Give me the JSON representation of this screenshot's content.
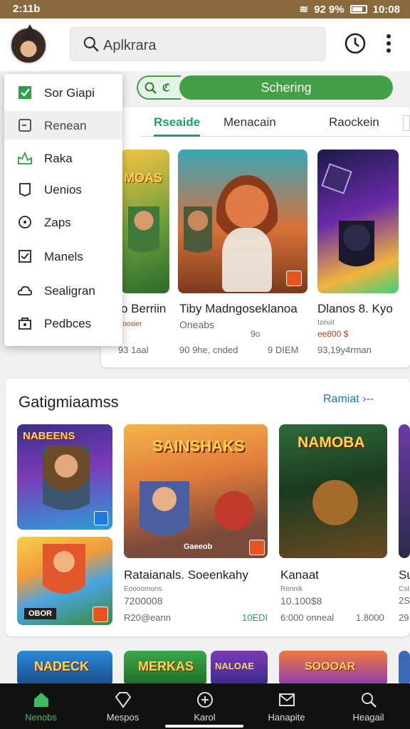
{
  "status": {
    "time": "2:11b",
    "right": "92 9% ",
    "clock": "10:08"
  },
  "search": {
    "placeholder": "Aplkrara"
  },
  "filter": {
    "button_label": "Schering",
    "search_mark": "ℭ"
  },
  "tabs": [
    {
      "label": "Rseaide",
      "active": true
    },
    {
      "label": "Menacain",
      "active": false
    },
    {
      "label": "Raockein",
      "active": false
    }
  ],
  "menu": [
    {
      "label": "Sor Giapi",
      "icon": "check-square-icon"
    },
    {
      "label": "Renean",
      "icon": "note-icon",
      "selected": true
    },
    {
      "label": "Raka",
      "icon": "chart-icon"
    },
    {
      "label": "Uenios",
      "icon": "bookmark-icon"
    },
    {
      "label": "Zaps",
      "icon": "compass-icon"
    },
    {
      "label": "Manels",
      "icon": "check-box-icon"
    },
    {
      "label": "Sealigran",
      "icon": "cloud-icon"
    },
    {
      "label": "Pedbces",
      "icon": "bag-icon"
    }
  ],
  "top_games": [
    {
      "title": "o Berriin",
      "sub": "ioosier",
      "meta": "93 1aal"
    },
    {
      "title": "Tiby Madngoseklanoa",
      "sub": "Oneabs",
      "rating": "9o",
      "meta": "90 9he, cnded",
      "size": "9 DIEM"
    },
    {
      "title": "Dlanos 8. Kyo",
      "sub": "Izeuit",
      "rating": "ee800 $",
      "meta": "93,19y4rman"
    }
  ],
  "section": {
    "title": "Gatigmiaamss",
    "link": "Ramiat",
    "link_arrow": "›‑‑",
    "tile_labels": {
      "left_top": "NABEENS",
      "left_bottom": "OBOR",
      "middle": "SAINSHAKS",
      "middle_tag": "Gaeeob",
      "right": "NAMOBA"
    },
    "games": [
      {
        "title": "Rataianals. Soeenkahy",
        "sub": "Eoooomons",
        "rating": "7200008",
        "meta": "R20@eann",
        "size": "10EDI"
      },
      {
        "title": "Kanaat",
        "sub": "Rennik",
        "rating": "10.100$8",
        "meta": "6:000 onneal",
        "size": "1.8000"
      },
      {
        "title": "Su",
        "sub": "Cst",
        "rating": "2S",
        "meta": "29"
      }
    ]
  },
  "bottom_tiles": {
    "first": "NADECK",
    "second": "MERKAS",
    "third": "NALOAE",
    "fourth": "SOOOAR"
  },
  "nav": [
    {
      "label": "Nenobs",
      "icon": "home-icon",
      "active": true
    },
    {
      "label": "Mespos",
      "icon": "diamond-icon"
    },
    {
      "label": "Karol",
      "icon": "plus-circle-icon"
    },
    {
      "label": "Hanapite",
      "icon": "envelope-icon"
    },
    {
      "label": "Heagail",
      "icon": "search-icon"
    }
  ],
  "colors": {
    "accent_green": "#43a047",
    "link_blue": "#1a73c9",
    "status_bar": "#8a6a3c",
    "nav_bg": "#111111"
  }
}
